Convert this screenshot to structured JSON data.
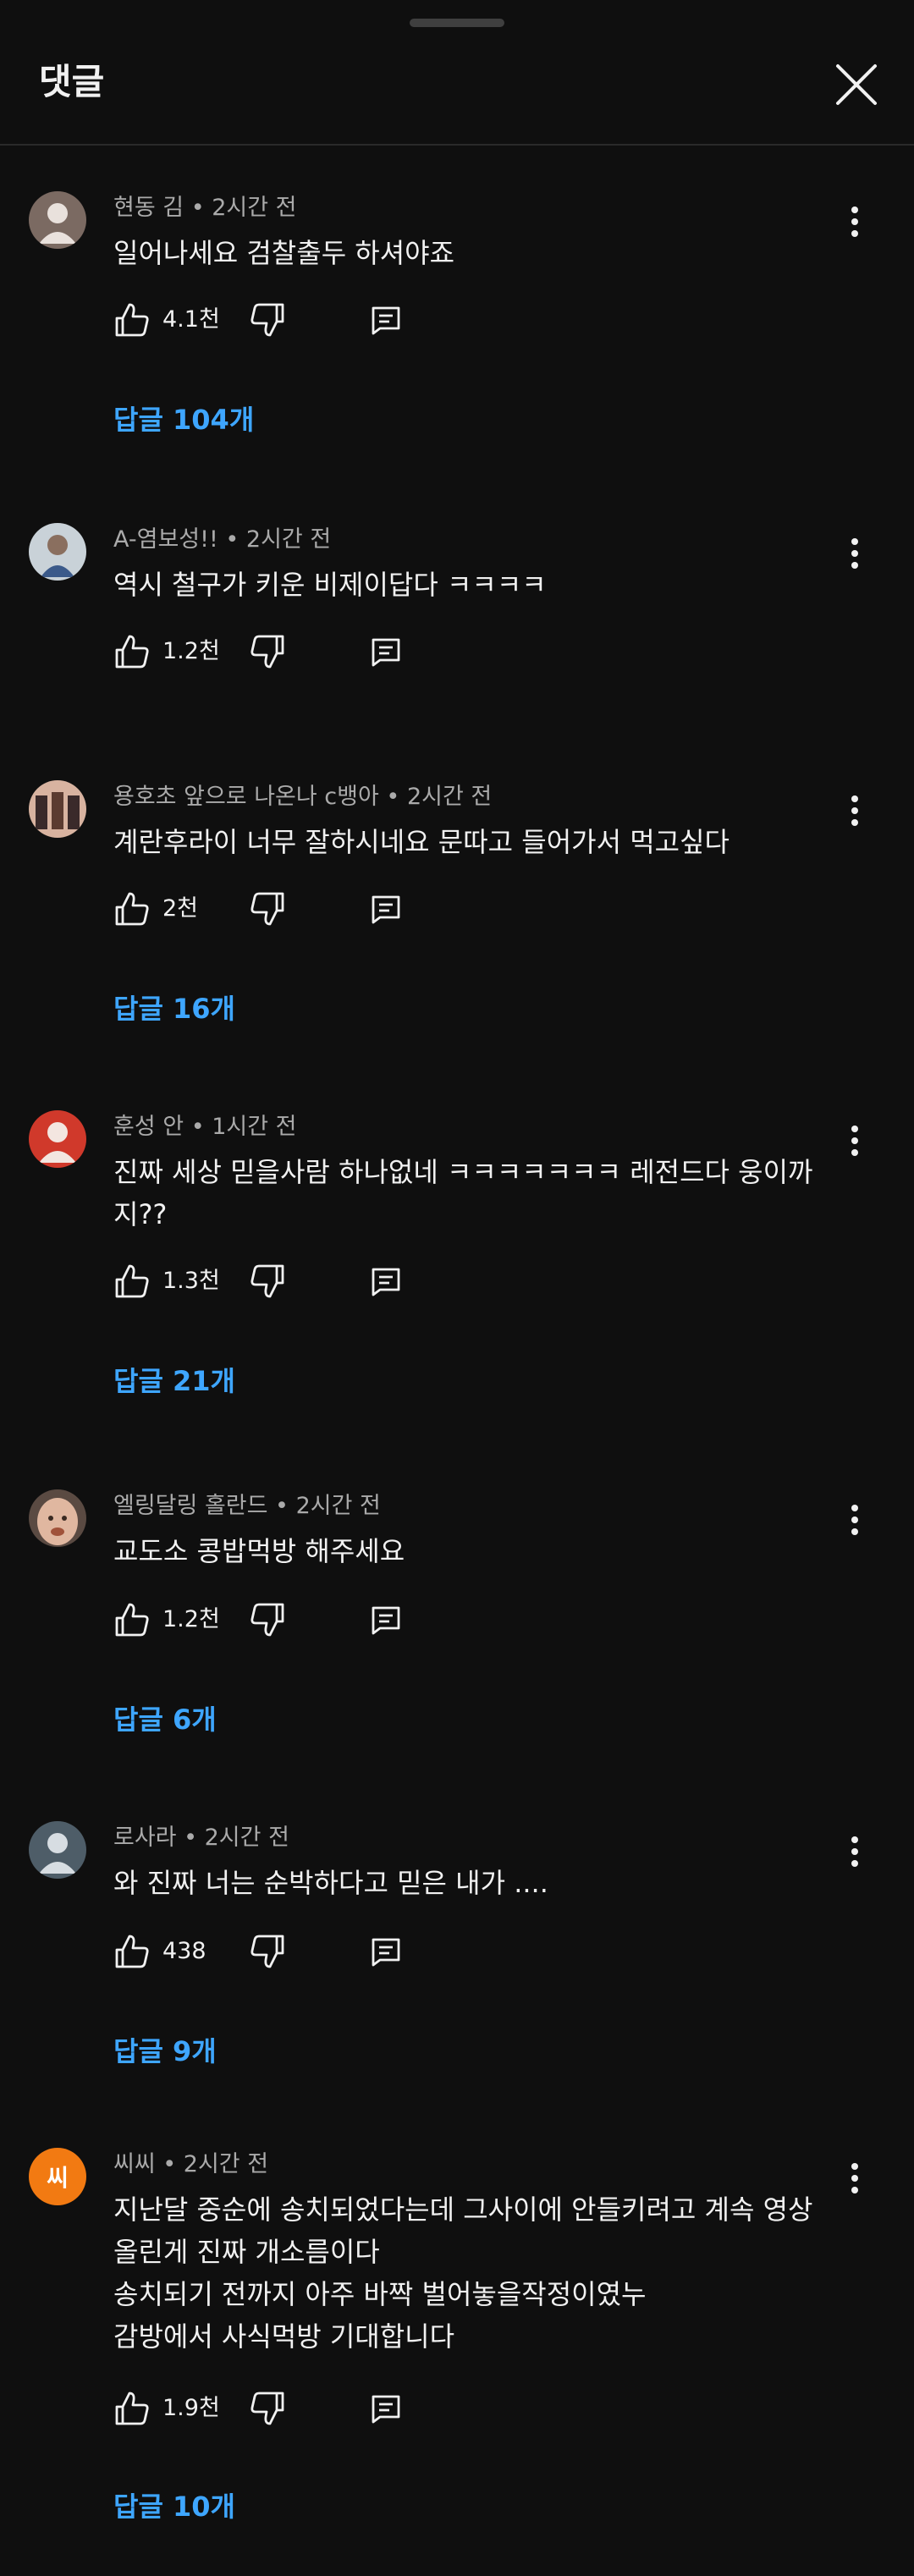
{
  "header": {
    "title": "댓글"
  },
  "comments": [
    {
      "author": "현동 김",
      "sep": " • ",
      "time": "2시간 전",
      "lines": [
        "일어나세요 검찰출두 하셔야죠"
      ],
      "likes": "4.1천",
      "replies": "답글 104개"
    },
    {
      "author": "A-염보성!!",
      "sep": " • ",
      "time": "2시간 전",
      "lines": [
        "역시 철구가 키운 비제이답다 ㅋㅋㅋㅋ"
      ],
      "likes": "1.2천"
    },
    {
      "author": "용호초 앞으로 나온나 c뱅아",
      "sep": " • ",
      "time": "2시간 전",
      "lines": [
        "계란후라이 너무 잘하시네요 문따고 들어가서 먹고싶다"
      ],
      "likes": "2천",
      "replies": "답글 16개"
    },
    {
      "author": "훈성 안",
      "sep": " • ",
      "time": "1시간 전",
      "lines": [
        "진짜 세상 믿을사람 하나없네 ㅋㅋㅋㅋㅋㅋㅋ 레전드다 웅이까",
        "지??"
      ],
      "likes": "1.3천",
      "replies": "답글 21개"
    },
    {
      "author": "엘링달링 홀란드",
      "sep": " • ",
      "time": "2시간 전",
      "lines": [
        "교도소 콩밥먹방 해주세요"
      ],
      "likes": "1.2천",
      "replies": "답글 6개"
    },
    {
      "author": "로사라",
      "sep": " • ",
      "time": "2시간 전",
      "lines": [
        "와 진짜 너는 순박하다고 믿은 내가 ...."
      ],
      "likes": "438",
      "replies": "답글 9개"
    },
    {
      "author": "씨씨",
      "sep": " • ",
      "time": "2시간 전",
      "avatar_letter": "씨",
      "lines": [
        "지난달 중순에 송치되었다는데 그사이에 안들키려고 계속 영상",
        "올린게 진짜 개소름이다",
        "송치되기 전까지 아주 바짝 벌어놓을작정이였누",
        "감방에서 사식먹방 기대합니다"
      ],
      "likes": "1.9천",
      "replies": "답글 10개"
    }
  ],
  "colors": {
    "background": "#0f0f0f",
    "text": "#f1f1f1",
    "meta": "#aaaaaa",
    "link": "#3ea6ff",
    "letter_avatar": "#f27a12"
  },
  "icons": {
    "like": "thumb-up-icon",
    "dislike": "thumb-down-icon",
    "reply": "comment-icon",
    "more": "more-vertical-icon",
    "close": "close-icon"
  }
}
